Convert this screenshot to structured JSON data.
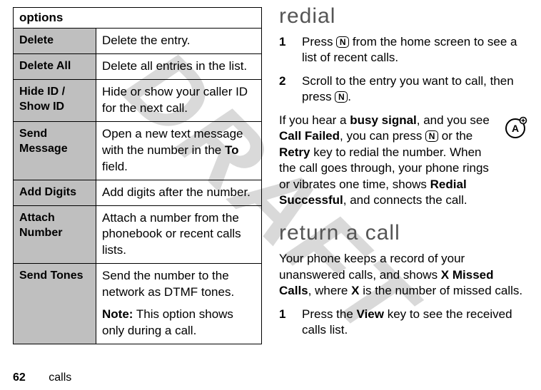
{
  "watermark": "DRAFT",
  "left": {
    "header": "options",
    "rows": [
      {
        "opt": "Delete",
        "desc_parts": [
          "Delete the entry."
        ]
      },
      {
        "opt": "Delete All",
        "desc_parts": [
          "Delete all entries in the list."
        ]
      },
      {
        "opt": "Hide ID / Show ID",
        "desc_parts": [
          "Hide or show your caller ID for the next call."
        ]
      },
      {
        "opt": "Send Message",
        "desc_parts": [
          "Open a new text message with the number in the ",
          "To",
          " field."
        ]
      },
      {
        "opt": "Add Digits",
        "desc_parts": [
          "Add digits after the number."
        ]
      },
      {
        "opt": "Attach Number",
        "desc_parts": [
          "Attach a number from the phonebook or recent calls lists."
        ]
      },
      {
        "opt": "Send Tones",
        "desc_parts": [
          "Send the number to the network as DTMF tones."
        ],
        "note_label": "Note:",
        "note_text": " This option shows only during a call."
      }
    ]
  },
  "right": {
    "h_redial": "redial",
    "step1_num": "1",
    "step1_a": "Press ",
    "step1_key": "N",
    "step1_b": " from the home screen to see a list of recent calls.",
    "step2_num": "2",
    "step2_a": "Scroll to the entry you want to call, then press ",
    "step2_key": "N",
    "step2_b": ".",
    "busy_a": "If you hear a ",
    "busy_bold1": "busy signal",
    "busy_b": ", and you see ",
    "busy_cond1": "Call Failed",
    "busy_c": ", you can press ",
    "busy_key": "N",
    "busy_d": " or the ",
    "busy_cond2": "Retry",
    "busy_e": " key to redial the number. When the call goes through, your phone rings or vibrates one time, shows ",
    "busy_cond3": "Redial Successful",
    "busy_f": ", and connects the call.",
    "h_return": "return a call",
    "ret_a": "Your phone keeps a record of your unanswered calls, and shows ",
    "ret_cond1": "X Missed Calls",
    "ret_b": ", where ",
    "ret_cond2": "X",
    "ret_c": " is the number of missed calls.",
    "ret_step1_num": "1",
    "ret_step1_a": "Press the ",
    "ret_step1_cond": "View",
    "ret_step1_b": " key to see the received calls list."
  },
  "footer": {
    "page": "62",
    "section": "calls"
  }
}
